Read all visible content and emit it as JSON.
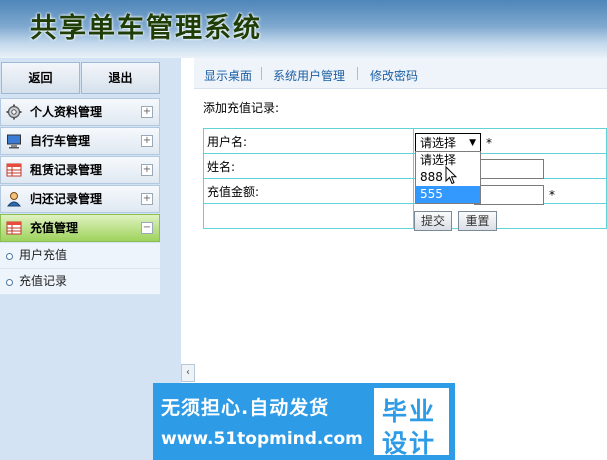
{
  "header": {
    "title": "共享单车管理系统"
  },
  "sidebar": {
    "back_label": "返回",
    "exit_label": "退出",
    "items": [
      {
        "label": "个人资料管理",
        "icon": "gear-icon",
        "toggle": "+"
      },
      {
        "label": "自行车管理",
        "icon": "monitor-icon",
        "toggle": "+"
      },
      {
        "label": "租赁记录管理",
        "icon": "table-icon",
        "toggle": "+"
      },
      {
        "label": "归还记录管理",
        "icon": "user-icon",
        "toggle": "+"
      },
      {
        "label": "充值管理",
        "icon": "table-red-icon",
        "toggle": "−"
      }
    ],
    "subitems": [
      {
        "label": "用户充值"
      },
      {
        "label": "充值记录"
      }
    ],
    "collapse_glyph": "‹"
  },
  "topnav": {
    "links": [
      {
        "label": "显示桌面"
      },
      {
        "label": "系统用户管理"
      },
      {
        "label": "修改密码"
      }
    ]
  },
  "form": {
    "section_title": "添加充值记录:",
    "user_label": "用户名:",
    "name_label": "姓名:",
    "amount_label": "充值金额:",
    "required_mark": "*",
    "select": {
      "selected": "请选择",
      "arrow": "▼",
      "options": [
        {
          "label": "请选择",
          "highlighted": false
        },
        {
          "label": "888",
          "highlighted": false
        },
        {
          "label": "555",
          "highlighted": true
        }
      ]
    },
    "name_value": "",
    "amount_value": "",
    "submit_label": "提交",
    "reset_label": "重置"
  },
  "banner": {
    "line1": "无须担心.自动发货",
    "line2": "www.51topmind.com",
    "box_line1": "毕业",
    "box_line2": "设计"
  },
  "colors": {
    "accent": "#1c5fa3",
    "active_menu": "#9ed35c",
    "table_border": "#5fd3d6",
    "option_highlight": "#3399ff",
    "banner": "#2d9be6"
  }
}
